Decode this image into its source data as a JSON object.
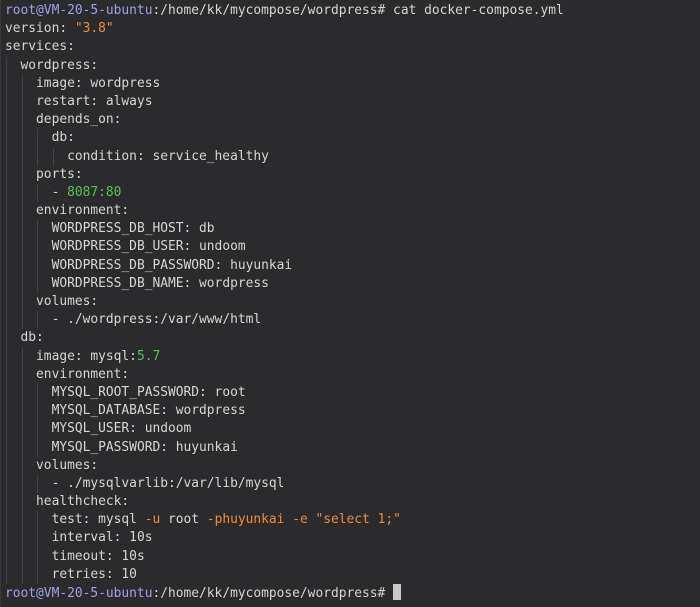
{
  "colors": {
    "default": "#d6d6d6",
    "prompt": "#9ea2e6",
    "orange": "#ef8a3c",
    "green": "#5cbf5c",
    "background": "#2b2b2d"
  },
  "terminal": {
    "lines": [
      {
        "indent": 0,
        "segments": [
          {
            "text": "root@VM-20-5-ubuntu",
            "color": "prompt"
          },
          {
            "text": ":/home/kk/mycompose/wordpress# cat docker-compose.yml",
            "color": "default"
          }
        ]
      },
      {
        "indent": 0,
        "segments": [
          {
            "text": "version: ",
            "color": "default"
          },
          {
            "text": "\"3.8\"",
            "color": "orange"
          }
        ]
      },
      {
        "indent": 0,
        "segments": [
          {
            "text": "services:",
            "color": "default"
          }
        ]
      },
      {
        "indent": 1,
        "segments": [
          {
            "text": "wordpress:",
            "color": "default"
          }
        ]
      },
      {
        "indent": 2,
        "segments": [
          {
            "text": "image: wordpress",
            "color": "default"
          }
        ]
      },
      {
        "indent": 2,
        "segments": [
          {
            "text": "restart: always",
            "color": "default"
          }
        ]
      },
      {
        "indent": 2,
        "segments": [
          {
            "text": "depends_on:",
            "color": "default"
          }
        ]
      },
      {
        "indent": 3,
        "segments": [
          {
            "text": "db:",
            "color": "default"
          }
        ]
      },
      {
        "indent": 4,
        "segments": [
          {
            "text": "condition: service_healthy",
            "color": "default"
          }
        ]
      },
      {
        "indent": 2,
        "segments": [
          {
            "text": "ports:",
            "color": "default"
          }
        ]
      },
      {
        "indent": 3,
        "segments": [
          {
            "text": "- ",
            "color": "default"
          },
          {
            "text": "8087:80",
            "color": "green"
          }
        ]
      },
      {
        "indent": 2,
        "segments": [
          {
            "text": "environment:",
            "color": "default"
          }
        ]
      },
      {
        "indent": 3,
        "segments": [
          {
            "text": "WORDPRESS_DB_HOST: db",
            "color": "default"
          }
        ]
      },
      {
        "indent": 3,
        "segments": [
          {
            "text": "WORDPRESS_DB_USER: undoom",
            "color": "default"
          }
        ]
      },
      {
        "indent": 3,
        "segments": [
          {
            "text": "WORDPRESS_DB_PASSWORD: huyunkai",
            "color": "default"
          }
        ]
      },
      {
        "indent": 3,
        "segments": [
          {
            "text": "WORDPRESS_DB_NAME: wordpress",
            "color": "default"
          }
        ]
      },
      {
        "indent": 2,
        "segments": [
          {
            "text": "volumes:",
            "color": "default"
          }
        ]
      },
      {
        "indent": 3,
        "segments": [
          {
            "text": "- ./wordpress:/var/www/html",
            "color": "default"
          }
        ]
      },
      {
        "indent": 1,
        "segments": [
          {
            "text": "db:",
            "color": "default"
          }
        ]
      },
      {
        "indent": 2,
        "segments": [
          {
            "text": "image: mysql:",
            "color": "default"
          },
          {
            "text": "5.7",
            "color": "green"
          }
        ]
      },
      {
        "indent": 2,
        "segments": [
          {
            "text": "environment:",
            "color": "default"
          }
        ]
      },
      {
        "indent": 3,
        "segments": [
          {
            "text": "MYSQL_ROOT_PASSWORD: root",
            "color": "default"
          }
        ]
      },
      {
        "indent": 3,
        "segments": [
          {
            "text": "MYSQL_DATABASE: wordpress",
            "color": "default"
          }
        ]
      },
      {
        "indent": 3,
        "segments": [
          {
            "text": "MYSQL_USER: undoom",
            "color": "default"
          }
        ]
      },
      {
        "indent": 3,
        "segments": [
          {
            "text": "MYSQL_PASSWORD: huyunkai",
            "color": "default"
          }
        ]
      },
      {
        "indent": 2,
        "segments": [
          {
            "text": "volumes:",
            "color": "default"
          }
        ]
      },
      {
        "indent": 3,
        "segments": [
          {
            "text": "- ./mysqlvarlib:/var/lib/mysql",
            "color": "default"
          }
        ]
      },
      {
        "indent": 2,
        "segments": [
          {
            "text": "healthcheck:",
            "color": "default"
          }
        ]
      },
      {
        "indent": 3,
        "segments": [
          {
            "text": "test: mysql ",
            "color": "default"
          },
          {
            "text": "-u",
            "color": "orange"
          },
          {
            "text": " root ",
            "color": "default"
          },
          {
            "text": "-phuyunkai -e \"select 1;\"",
            "color": "orange"
          }
        ]
      },
      {
        "indent": 3,
        "segments": [
          {
            "text": "interval: 10s",
            "color": "default"
          }
        ]
      },
      {
        "indent": 3,
        "segments": [
          {
            "text": "timeout: 10s",
            "color": "default"
          }
        ]
      },
      {
        "indent": 3,
        "segments": [
          {
            "text": "retries: 10",
            "color": "default"
          }
        ]
      },
      {
        "indent": 0,
        "cursor": true,
        "segments": [
          {
            "text": "root@VM-20-5-ubuntu",
            "color": "prompt"
          },
          {
            "text": ":/home/kk/mycompose/wordpress# ",
            "color": "default"
          }
        ]
      }
    ]
  }
}
